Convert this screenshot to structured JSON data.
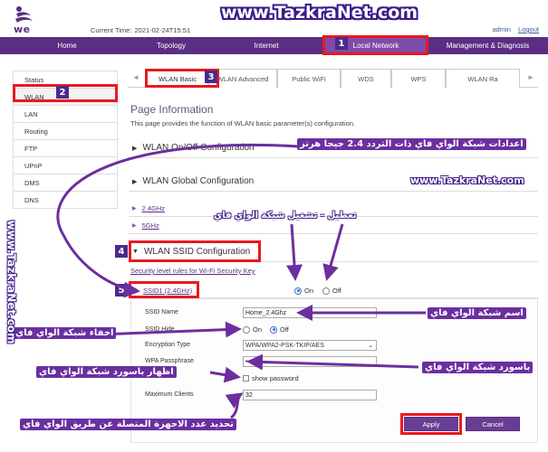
{
  "header": {
    "logo_text": "we",
    "current_time_label": "Current Time:",
    "current_time_value": "2021-02-24T15:51",
    "admin_link": "admin",
    "logout_link": "Logout"
  },
  "watermark": {
    "top": "www.TazkraNet.com",
    "middle": "www.TazkraNet.com",
    "side": "www.TazkraNet.com"
  },
  "nav": {
    "items": [
      {
        "label": "Home"
      },
      {
        "label": "Topology"
      },
      {
        "label": "Internet"
      },
      {
        "label": "Local Network"
      },
      {
        "label": "Management & Diagnosis"
      }
    ]
  },
  "sidebar": {
    "items": [
      {
        "label": "Status"
      },
      {
        "label": "WLAN"
      },
      {
        "label": "LAN"
      },
      {
        "label": "Routing"
      },
      {
        "label": "FTP"
      },
      {
        "label": "UPnP"
      },
      {
        "label": "DMS"
      },
      {
        "label": "DNS"
      }
    ]
  },
  "tabs": {
    "items": [
      {
        "label": "WLAN Basic"
      },
      {
        "label": "WLAN Advanced"
      },
      {
        "label": "Public WiFi"
      },
      {
        "label": "WDS"
      },
      {
        "label": "WPS"
      },
      {
        "label": "WLAN Ra"
      }
    ],
    "left_arrow": "◄",
    "right_arrow": "►"
  },
  "content": {
    "page_title": "Page Information",
    "page_desc": "This page provides the function of WLAN basic parameter(s) configuration.",
    "section_onoff": "WLAN On/Off Configuration",
    "section_global": "WLAN Global Configuration",
    "band_24": "2.4GHz",
    "band_5": "5GHz",
    "section_ssid": "WLAN SSID Configuration",
    "security_link": "Security level rules for Wi-Fi Security Key",
    "ssid_row": "SSID1 (2.4GHz)",
    "on_label": "On",
    "off_label": "Off"
  },
  "form": {
    "ssid_name_label": "SSID Name",
    "ssid_name_value": "Home_2.4Ghz",
    "ssid_hide_label": "SSID Hide",
    "hide_on": "On",
    "hide_off": "Off",
    "encryption_label": "Encryption Type",
    "encryption_value": "WPA/WPA2-PSK-TKIP/AES",
    "passphrase_label": "WPA Passphrase",
    "passphrase_value": "•••••••",
    "show_password_label": "show password",
    "max_clients_label": "Maximum Clients",
    "max_clients_value": "32",
    "apply_button": "Apply",
    "cancel_button": "Cancel"
  },
  "annotations": {
    "badges": [
      "1",
      "2",
      "3",
      "4",
      "5"
    ],
    "ann_24ghz": "اعدادات شبكة الواي فاي ذات التردد 2.4 جيجا هرتز",
    "ann_onoff": "تعطيل  -  تشغيل شبكة الواي فاي",
    "ann_ssid_name": "اسم شبكة الواي فاي",
    "ann_hide": "اخفاء شبكة الواي فاي",
    "ann_password": "باسورد شبكة الواي فاي",
    "ann_show_password": "اظهار باسورد شبكة الواي فاي",
    "ann_max_clients": "تحديد عدد الاجهزة المتصلة عن طريق الواي فاي"
  },
  "colors": {
    "brand_purple": "#5a2e82",
    "nav_active": "#7f4ba8",
    "annotation_red": "#e8191f",
    "annotation_purple": "#6b2fa0"
  }
}
